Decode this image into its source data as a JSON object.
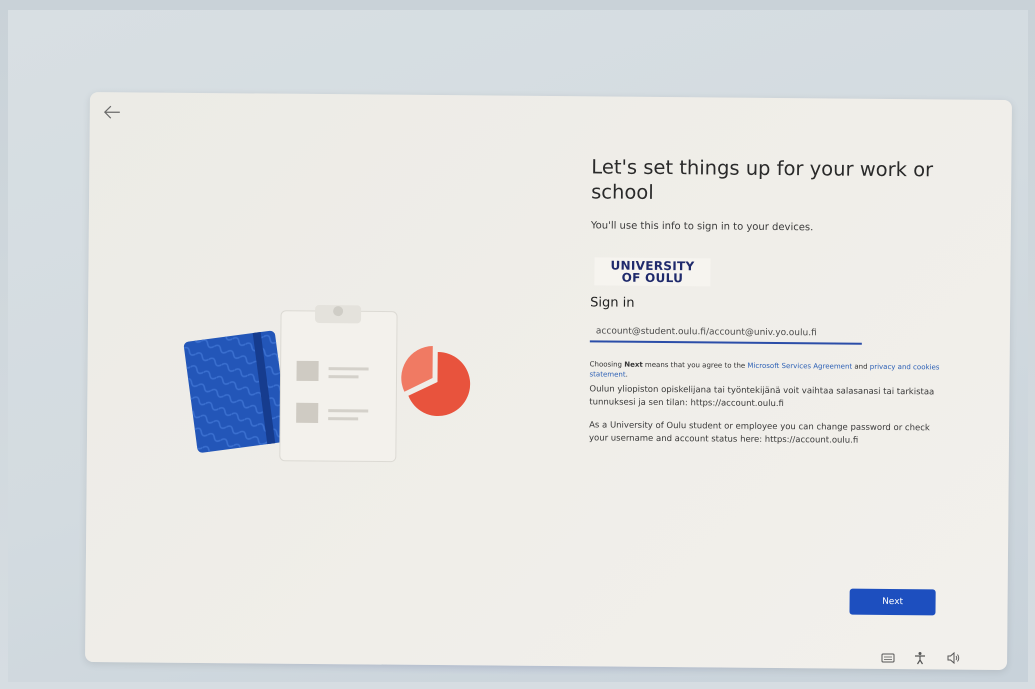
{
  "header": {
    "title": "Let's set things up for your work or school",
    "subtitle": "You'll use this info to sign in to your devices."
  },
  "logo": {
    "line1": "UNIVERSITY",
    "line2": "OF OULU"
  },
  "signin": {
    "label": "Sign in",
    "input_value": "account@student.oulu.fi/account@univ.yo.oulu.fi"
  },
  "agreement": {
    "prefix": "Choosing ",
    "next_word": "Next",
    "middle": " means that you agree to the ",
    "msa_link": "Microsoft Services Agreement",
    "and": " and ",
    "privacy_link": "privacy and cookies statement",
    "end": "."
  },
  "info": {
    "finnish": "Oulun yliopiston opiskelijana tai työntekijänä voit vaihtaa salasanasi tai tarkistaa tunnuksesi ja sen tilan: https://account.oulu.fi",
    "english": "As a University of Oulu student or employee you can change password or check your username and account status here: https://account.oulu.fi"
  },
  "buttons": {
    "next": "Next"
  },
  "icons": {
    "back": "back-arrow-icon",
    "keyboard": "keyboard-icon",
    "accessibility": "accessibility-icon",
    "volume": "volume-icon"
  },
  "colors": {
    "accent": "#1d4fbf",
    "link": "#2b5fb5",
    "logo": "#1f2a6c",
    "book": "#2356b8",
    "pie": "#e8533d"
  }
}
